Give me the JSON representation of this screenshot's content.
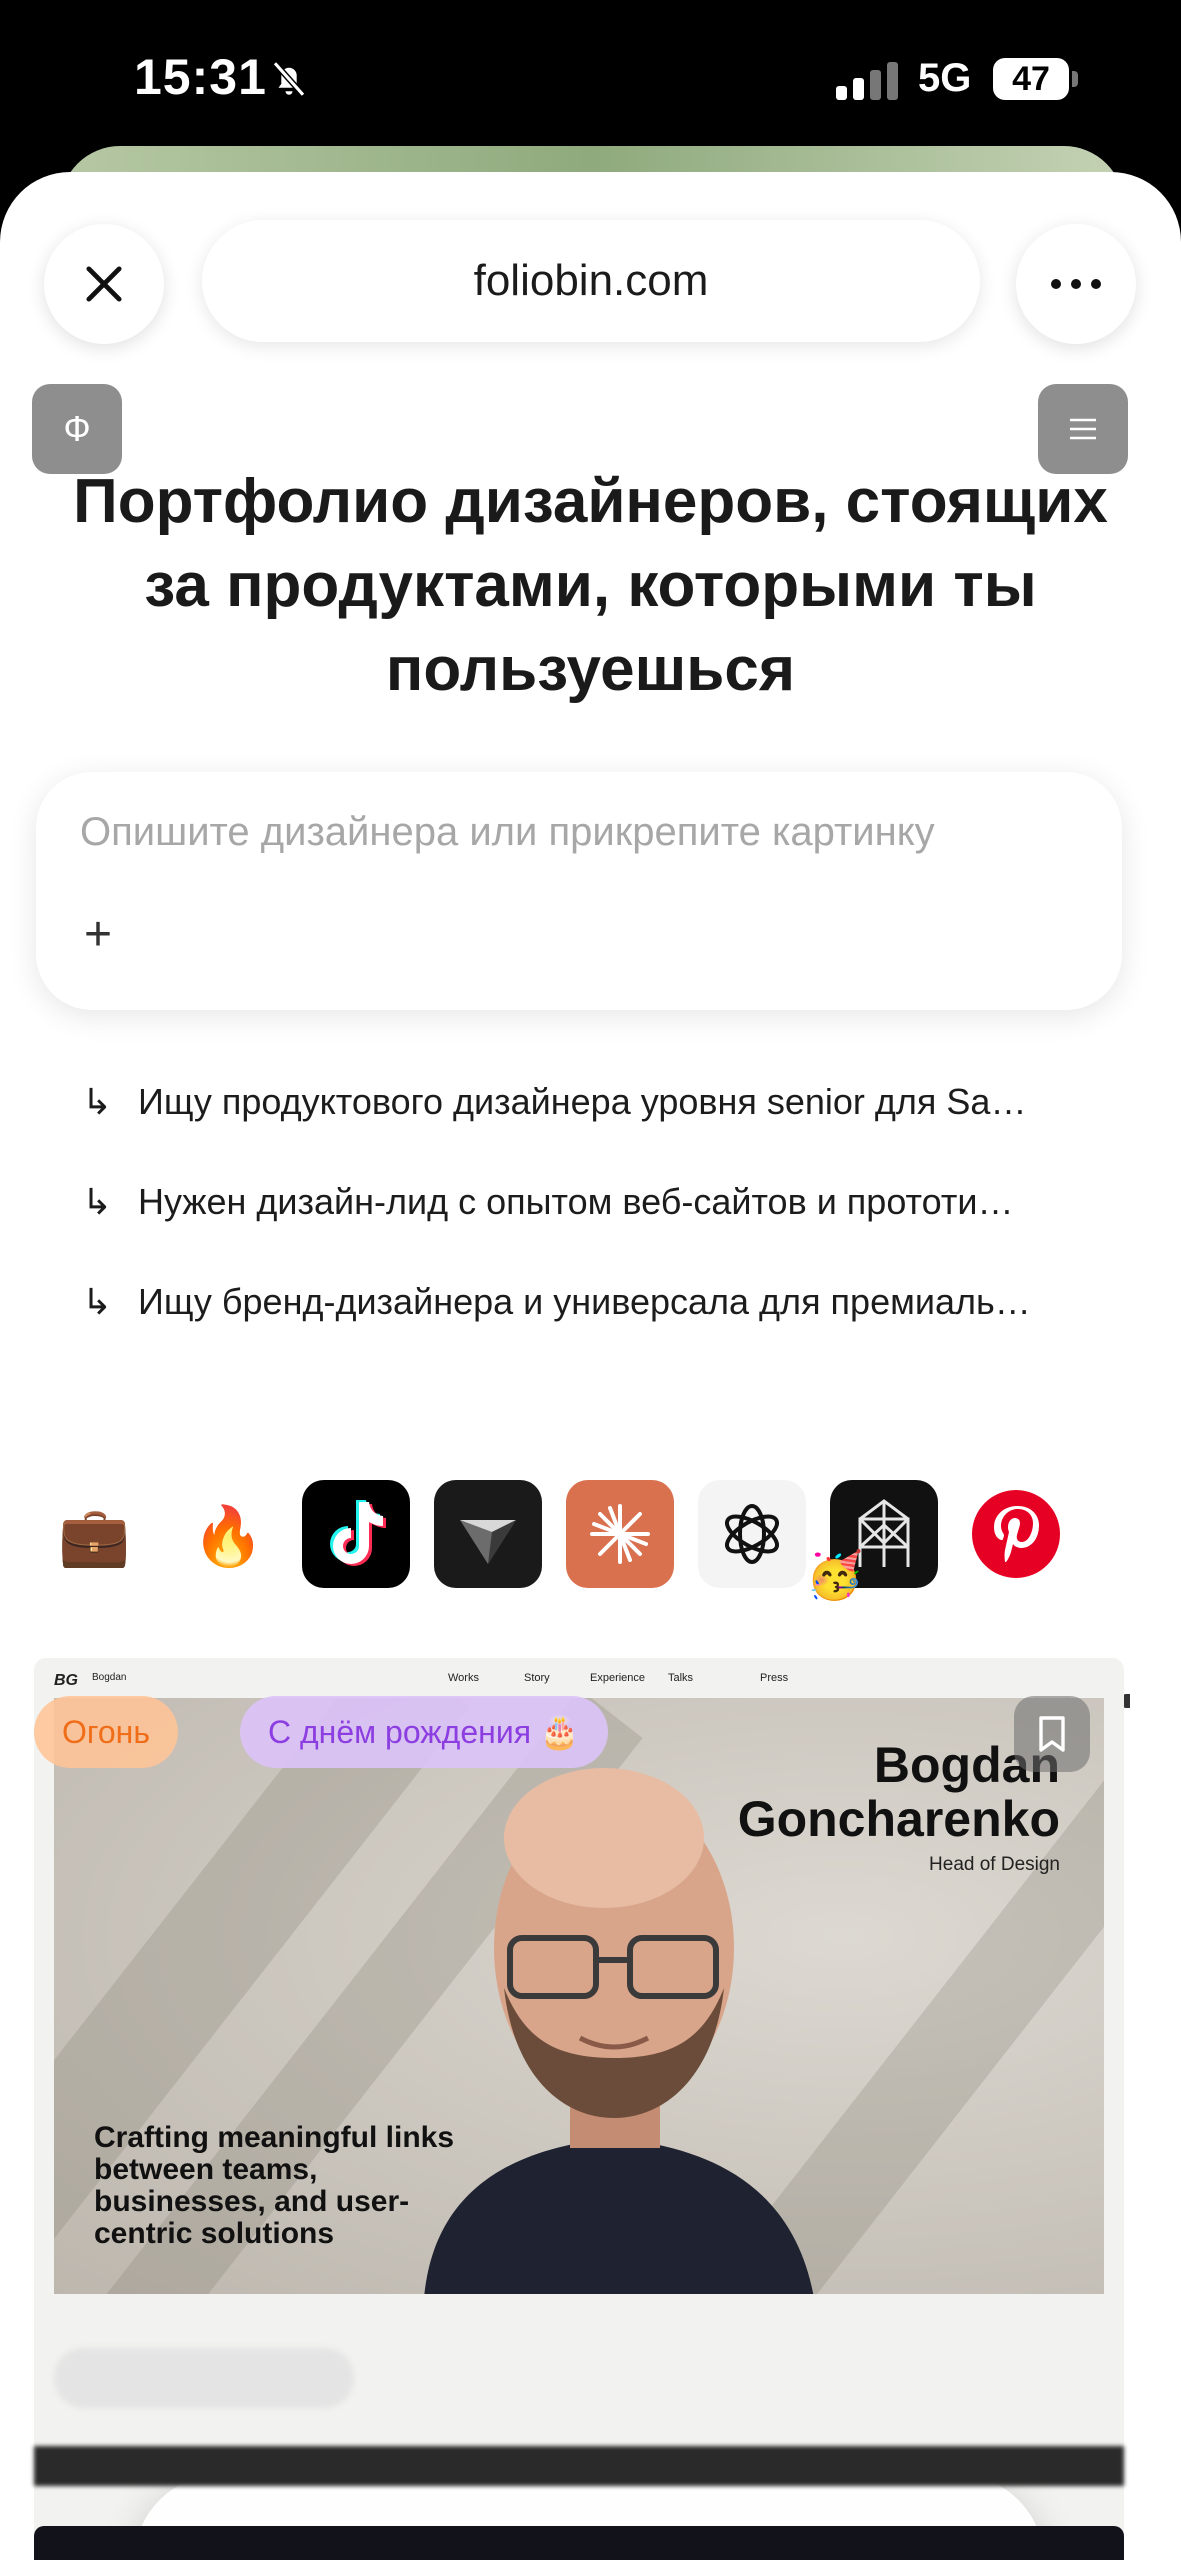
{
  "status_bar": {
    "time": "15:31",
    "network": "5G",
    "battery": "47"
  },
  "browser": {
    "url": "foliobin.com"
  },
  "site": {
    "logo_letter": "Ф",
    "title": "Портфолио дизайнеров, стоящих за продуктами, которыми ты пользуешься",
    "search_placeholder": "Опишите дизайнера или прикрепите картинку",
    "attach_label": "+",
    "suggestions": [
      "Ищу продуктового дизайнера уровня senior для Sa…",
      "Нужен дизайн-лид с опытом веб-сайтов и прототи…",
      "Ищу бренд-дизайнера и универсала для премиаль…"
    ],
    "suggestion_arrow": "↳"
  },
  "category_icons": [
    {
      "name": "briefcase-icon",
      "glyph": "💼"
    },
    {
      "name": "fire-icon",
      "glyph": "🔥"
    },
    {
      "name": "tiktok-icon"
    },
    {
      "name": "linear-prism-icon"
    },
    {
      "name": "claude-icon"
    },
    {
      "name": "openai-icon"
    },
    {
      "name": "perplexity-icon"
    },
    {
      "name": "pinterest-icon"
    }
  ],
  "portfolio_card": {
    "tags": {
      "fire": "Огонь",
      "birthday": "С днём рождения 🎂"
    },
    "nav_logo": "BG",
    "nav_name": "Bogdan",
    "nav_items": [
      "Works",
      "Story",
      "Experience",
      "Talks",
      "Press"
    ],
    "hero_name_line1": "Bogdan",
    "hero_name_line2": "Goncharenko",
    "hero_role": "Head of Design",
    "hero_tagline": "Crafting meaningful links between teams, businesses, and user-centric solutions"
  },
  "colors": {
    "accent_fire": "#f06d1a",
    "accent_birthday": "#8c3ee0",
    "pinterest": "#e60023",
    "claude": "#d9704e"
  }
}
